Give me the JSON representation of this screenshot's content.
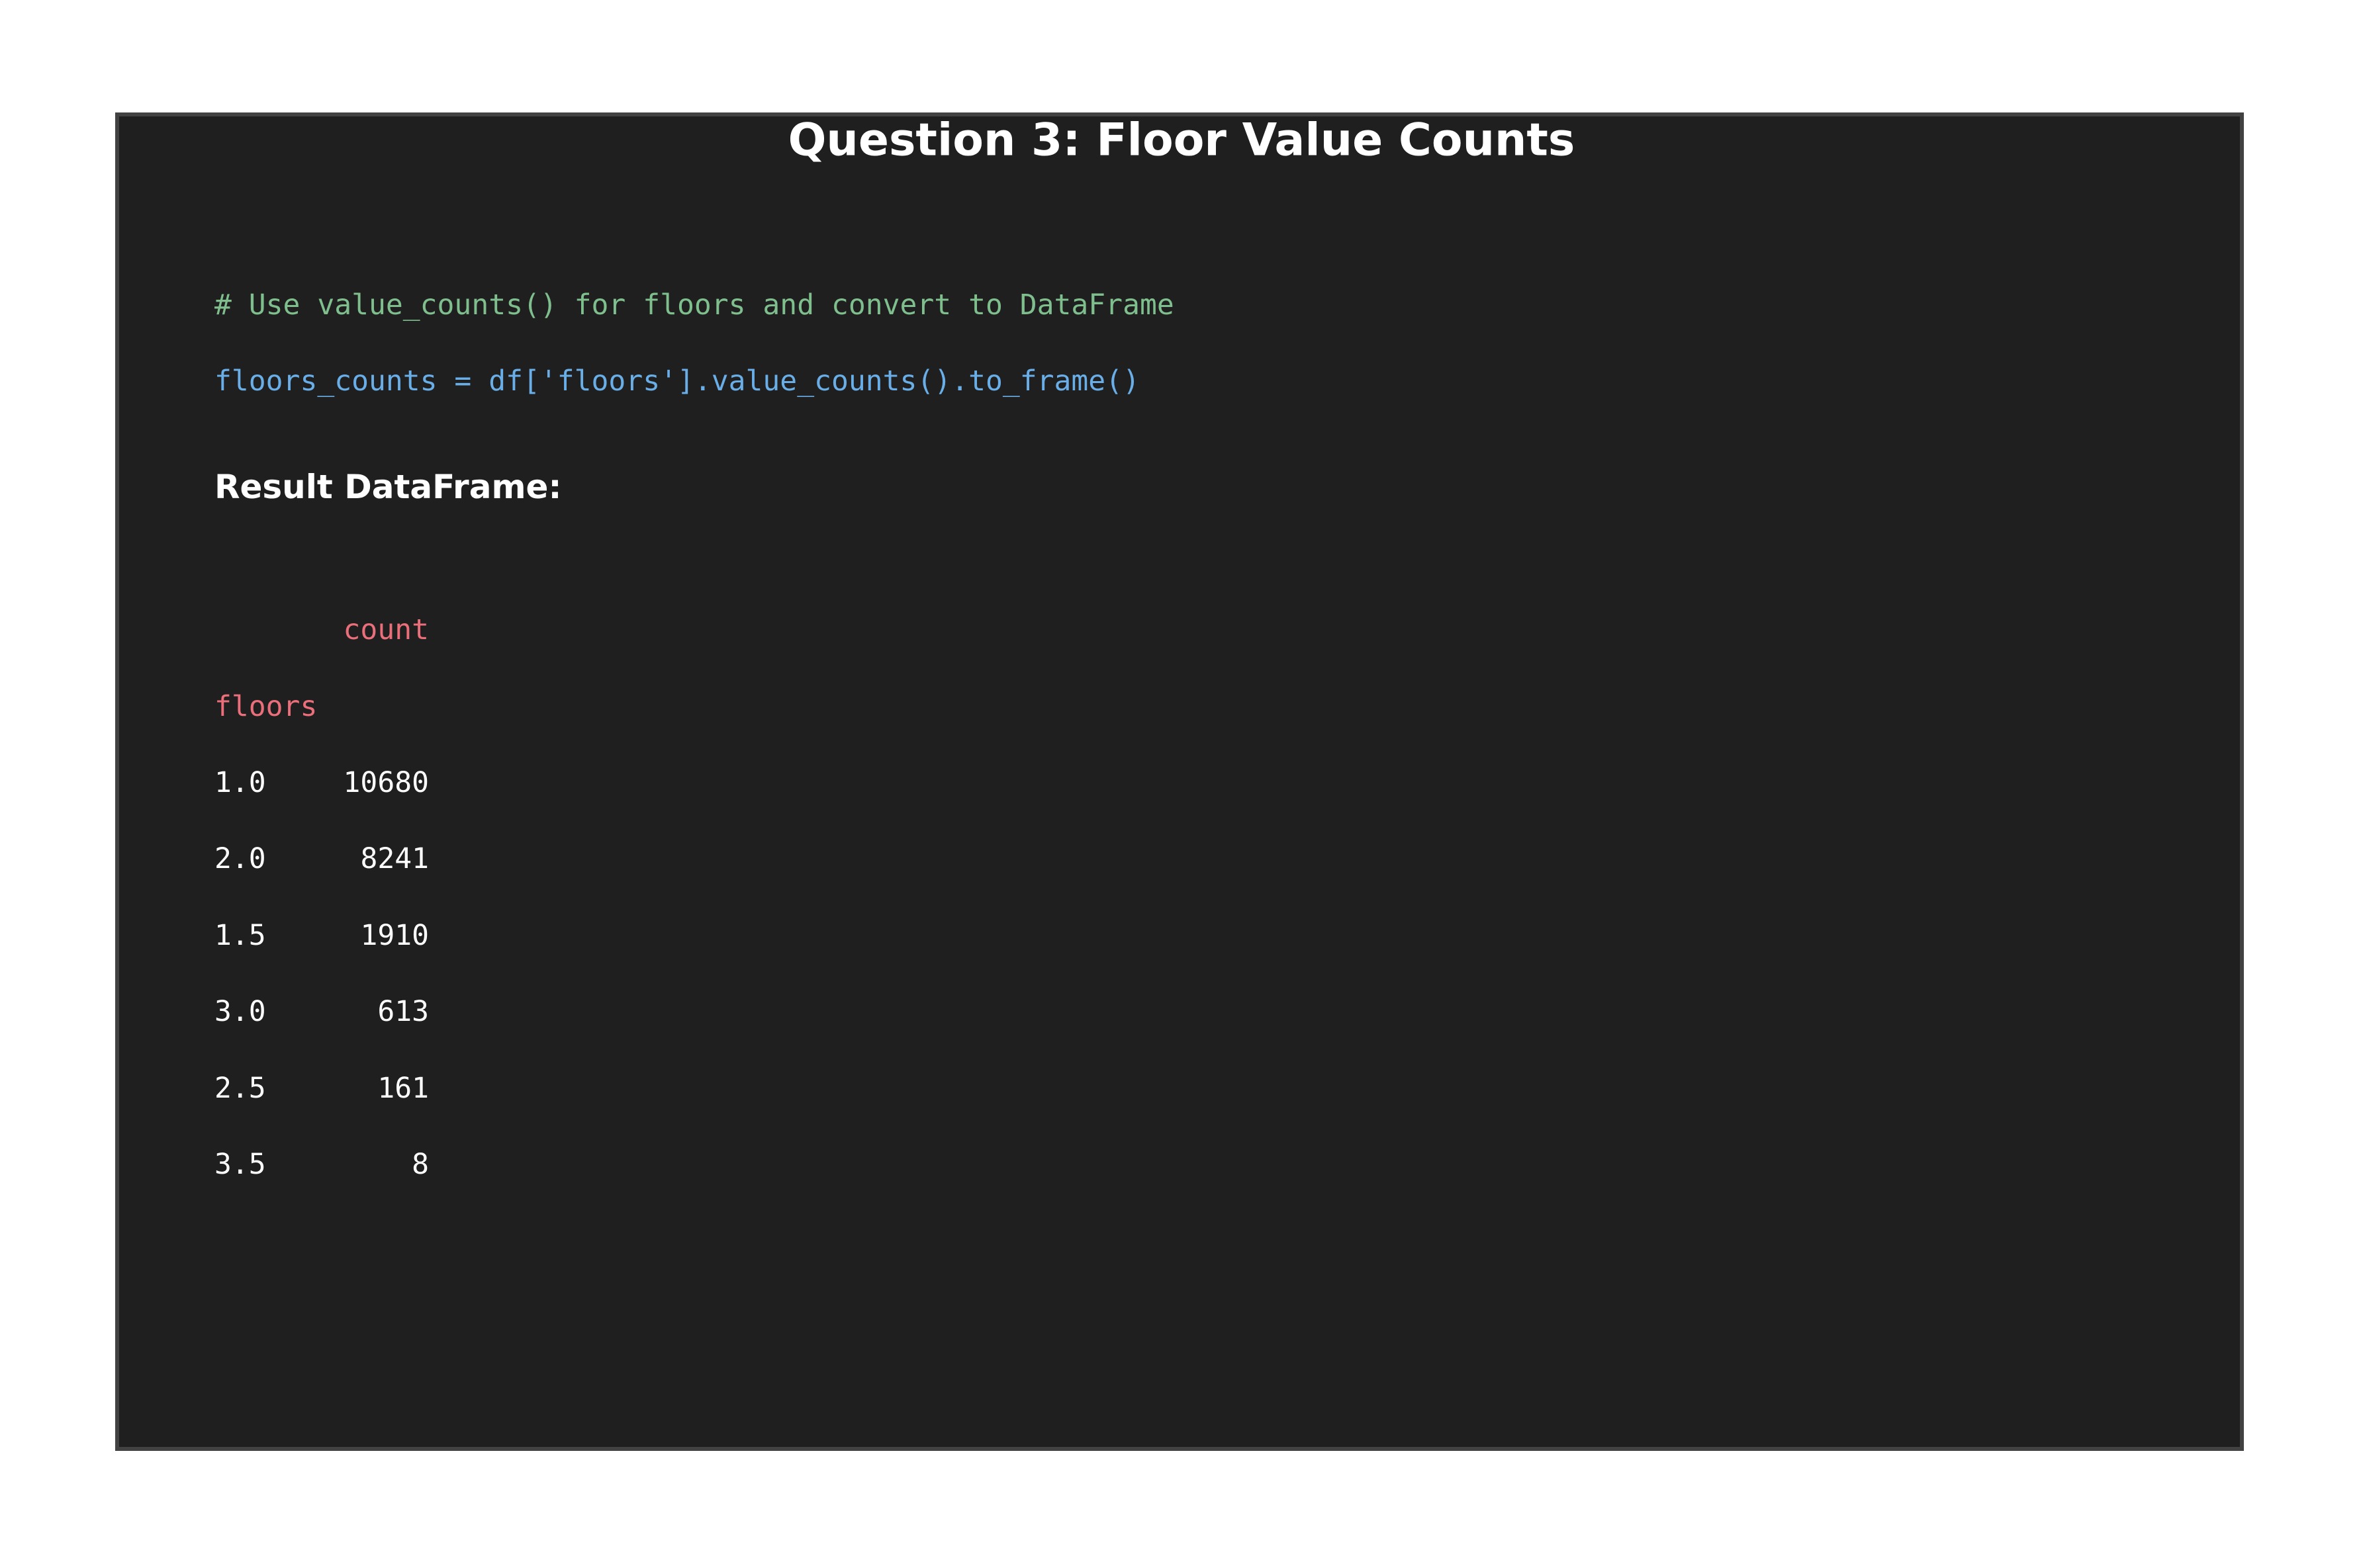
{
  "title": "Question 3: Floor Value Counts",
  "code": {
    "comment": "# Use value_counts() for floors and convert to DataFrame",
    "statement": "floors_counts = df['floors'].value_counts().to_frame()"
  },
  "result_heading": "Result DataFrame:",
  "dataframe": {
    "column_header": "count",
    "index_name": "floors",
    "rows": [
      {
        "index": "1.0",
        "count": "10680"
      },
      {
        "index": "2.0",
        "count": "8241"
      },
      {
        "index": "1.5",
        "count": "1910"
      },
      {
        "index": "3.0",
        "count": "613"
      },
      {
        "index": "2.5",
        "count": "161"
      },
      {
        "index": "3.5",
        "count": "8"
      }
    ]
  },
  "colors": {
    "background": "#1f1f1f",
    "border": "#424242",
    "comment": "#7fbf8e",
    "code": "#6aaee8",
    "header": "#ea6f7b",
    "text": "#ffffff"
  }
}
